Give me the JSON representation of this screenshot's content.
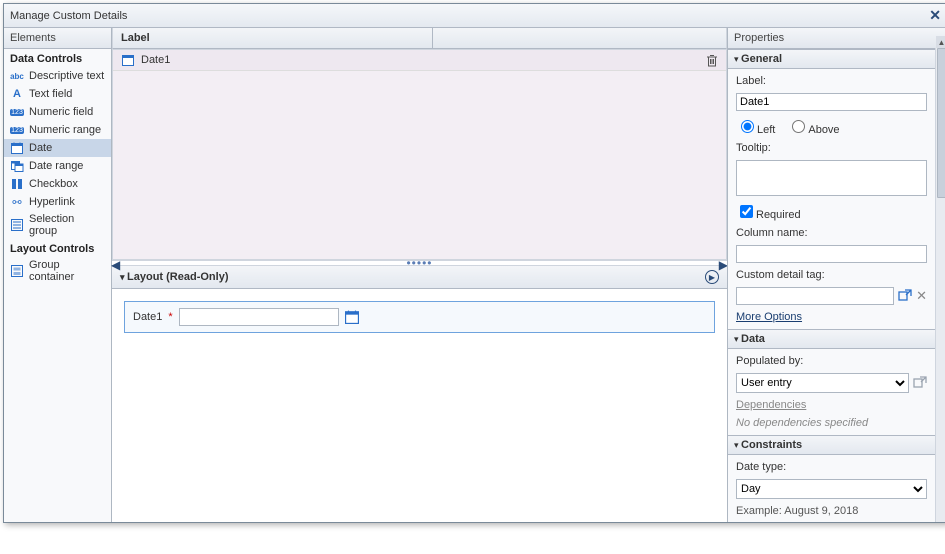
{
  "window": {
    "title": "Manage Custom Details"
  },
  "sidebar": {
    "header": "Elements",
    "section1": "Data Controls",
    "section2": "Layout Controls",
    "items": [
      {
        "label": "Descriptive text"
      },
      {
        "label": "Text field"
      },
      {
        "label": "Numeric field"
      },
      {
        "label": "Numeric range"
      },
      {
        "label": "Date"
      },
      {
        "label": "Date range"
      },
      {
        "label": "Checkbox"
      },
      {
        "label": "Hyperlink"
      },
      {
        "label": "Selection group"
      }
    ],
    "layoutItems": [
      {
        "label": "Group container"
      }
    ]
  },
  "canvas": {
    "header": "Label",
    "row_label": "Date1",
    "layout_header": "Layout (Read-Only)",
    "preview_label": "Date1"
  },
  "props": {
    "header": "Properties",
    "general_header": "General",
    "label_lbl": "Label:",
    "label_val": "Date1",
    "pos_left": "Left",
    "pos_above": "Above",
    "tooltip_lbl": "Tooltip:",
    "tooltip_val": "",
    "required_lbl": "Required",
    "colname_lbl": "Column name:",
    "colname_val": "",
    "tag_lbl": "Custom detail tag:",
    "tag_val": "",
    "more_options": "More Options",
    "data_header": "Data",
    "populated_lbl": "Populated by:",
    "populated_val": "User entry",
    "dependencies": "Dependencies",
    "no_deps": "No dependencies specified",
    "constraints_header": "Constraints",
    "datetype_lbl": "Date type:",
    "datetype_val": "Day",
    "example": "Example: August 9, 2018"
  }
}
